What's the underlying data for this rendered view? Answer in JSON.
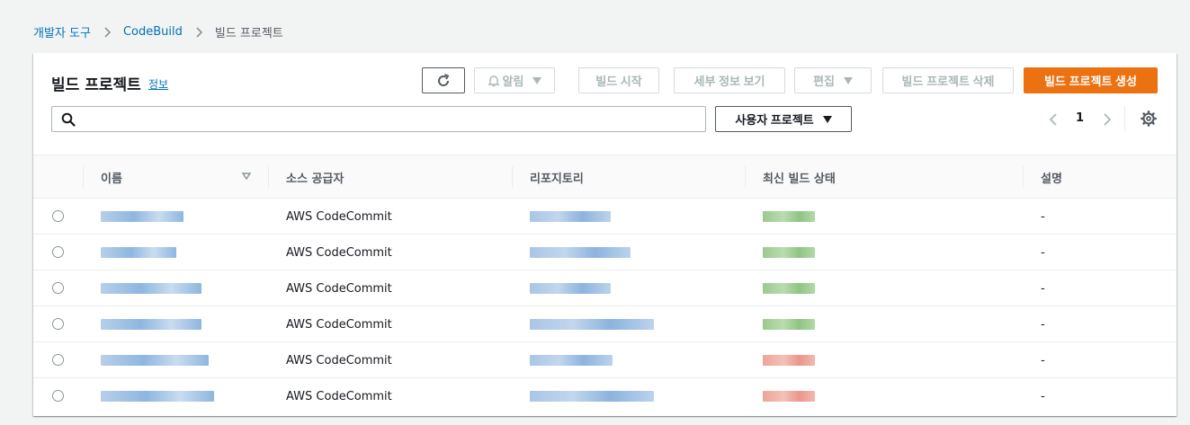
{
  "breadcrumb": {
    "items": [
      "개발자 도구",
      "CodeBuild"
    ],
    "current": "빌드 프로젝트"
  },
  "panel": {
    "title": "빌드 프로젝트",
    "info_link": "정보"
  },
  "toolbar": {
    "refresh_icon": "refresh-icon",
    "alarm_label": "알림",
    "alarm_icon": "bell-icon",
    "start_label": "빌드 시작",
    "details_label": "세부 정보 보기",
    "edit_label": "편집",
    "delete_label": "빌드 프로젝트 삭제",
    "create_label": "빌드 프로젝트 생성"
  },
  "search": {
    "placeholder": "",
    "value": ""
  },
  "filter": {
    "selected": "사용자 프로젝트"
  },
  "pagination": {
    "current_page": "1"
  },
  "table": {
    "columns": [
      "이름",
      "소스 공급자",
      "리포지토리",
      "최신 빌드 상태",
      "설명"
    ],
    "rows": [
      {
        "source": "AWS CodeCommit",
        "status": "succeeded",
        "description": "-"
      },
      {
        "source": "AWS CodeCommit",
        "status": "succeeded",
        "description": "-"
      },
      {
        "source": "AWS CodeCommit",
        "status": "succeeded",
        "description": "-"
      },
      {
        "source": "AWS CodeCommit",
        "status": "succeeded",
        "description": "-"
      },
      {
        "source": "AWS CodeCommit",
        "status": "failed",
        "description": "-"
      },
      {
        "source": "AWS CodeCommit",
        "status": "failed",
        "description": "-"
      }
    ]
  },
  "colors": {
    "link": "#0073bb",
    "primary": "#ec7211",
    "success": "#1d8102",
    "error": "#d13212"
  }
}
